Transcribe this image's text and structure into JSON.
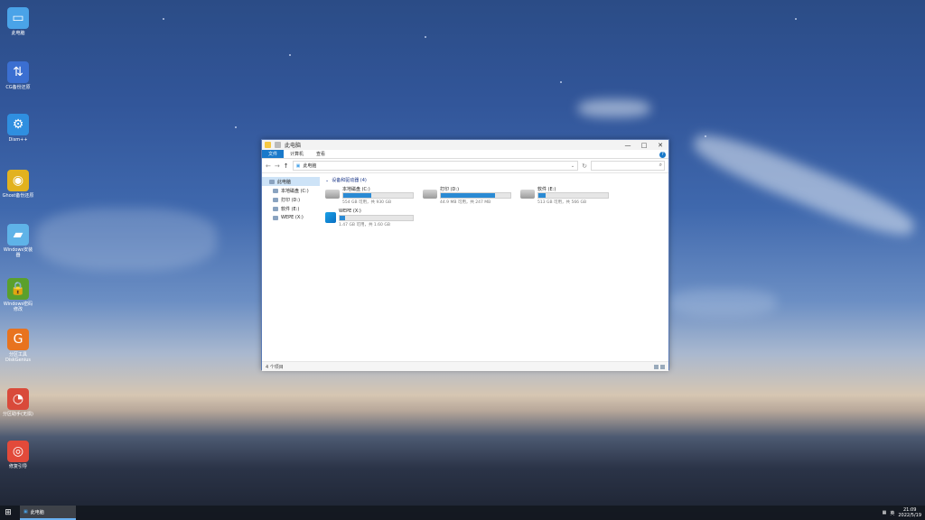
{
  "desktop": {
    "icons": [
      {
        "label": "此电脑",
        "icon": "computer-icon",
        "color": "#4aa3e8"
      },
      {
        "label": "CG备份还原",
        "icon": "backup-icon",
        "color": "#3b6fd1"
      },
      {
        "label": "Dism++",
        "icon": "gears-icon",
        "color": "#2f8fe0"
      },
      {
        "label": "Ghost备份还原",
        "icon": "ghost-icon",
        "color": "#e2b21f"
      },
      {
        "label": "Windows安装器",
        "icon": "installer-icon",
        "color": "#5fb3e8"
      },
      {
        "label": "Windows密码修改",
        "icon": "lock-icon",
        "color": "#5aa02c"
      },
      {
        "label": "分区工具DiskGenius",
        "icon": "diskgenius-icon",
        "color": "#e8731f"
      },
      {
        "label": "分区助手(无损)",
        "icon": "partition-icon",
        "color": "#d94a3a"
      },
      {
        "label": "修复引导",
        "icon": "lifebuoy-icon",
        "color": "#e24a3a"
      }
    ]
  },
  "explorer": {
    "title": "此电脑",
    "ribbon_tabs": [
      "文件",
      "计算机",
      "查看"
    ],
    "address": "此电脑",
    "sidebar": [
      "此电脑",
      "本地磁盘 (C:)",
      "打印 (D:)",
      "软件 (E:)",
      "WEPE (X:)"
    ],
    "group_header": "设备和驱动器 (4)",
    "drives": [
      {
        "name": "本地磁盘 (C:)",
        "size": "554 GB 可用，共 930 GB",
        "used": 0.4,
        "icon": "drive-icon"
      },
      {
        "name": "打印 (D:)",
        "size": "44.9 MB 可用，共 247 MB",
        "used": 0.78,
        "icon": "drive-icon"
      },
      {
        "name": "软件 (E:)",
        "size": "513 GB 可用，共 566 GB",
        "used": 0.1,
        "icon": "drive-icon"
      },
      {
        "name": "WEPE (X:)",
        "size": "1.47 GB 可用，共 1.60 GB",
        "used": 0.08,
        "icon": "windows-drive-icon"
      }
    ],
    "status": "4 个项目"
  },
  "taskbar": {
    "task_label": "此电脑",
    "tray_lang": "英",
    "time": "21:09",
    "date": "2022/5/19"
  }
}
